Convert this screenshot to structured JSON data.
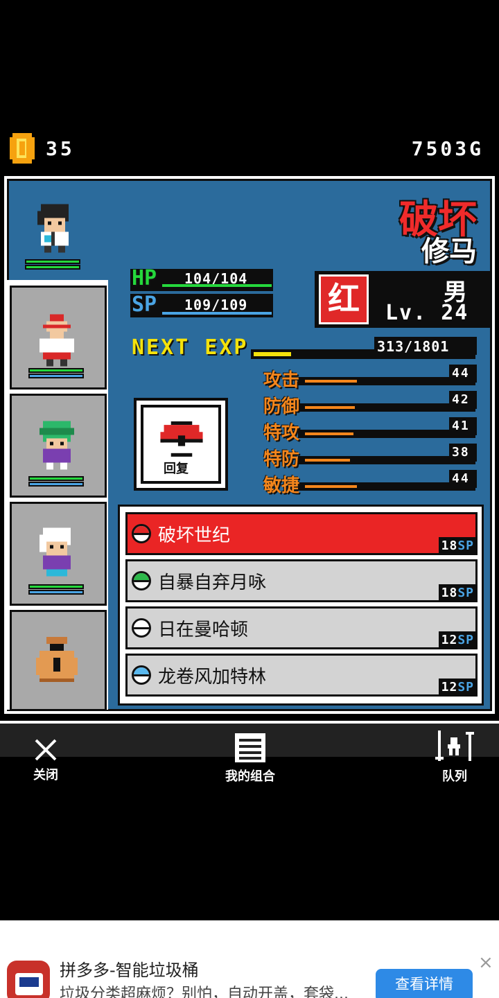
{
  "topbar": {
    "coins": "35",
    "gold": "7503G"
  },
  "character": {
    "title_red": "破坏",
    "name": "修马",
    "gender": "男",
    "type_badge": "红",
    "level": "Lv. 24"
  },
  "stats": {
    "hp": {
      "label": "HP",
      "value": "104/104",
      "fraction": 1.0
    },
    "sp": {
      "label": "SP",
      "value": "109/109",
      "fraction": 1.0
    },
    "exp": {
      "label": "NEXT EXP",
      "value": "313/1801",
      "fraction": 0.17
    }
  },
  "attributes": [
    {
      "name": "攻击",
      "value": "44"
    },
    {
      "name": "防御",
      "value": "42"
    },
    {
      "name": "特攻",
      "value": "41"
    },
    {
      "name": "特防",
      "value": "38"
    },
    {
      "name": "敏捷",
      "value": "44"
    }
  ],
  "item": {
    "label": "回复"
  },
  "skills": [
    {
      "name": "破坏世纪",
      "cost": "18",
      "unit": "SP",
      "ball_color": "#e02828",
      "active": true
    },
    {
      "name": "自暴自弃月咏",
      "cost": "18",
      "unit": "SP",
      "ball_color": "#2cb84a",
      "active": false
    },
    {
      "name": "日在曼哈顿",
      "cost": "12",
      "unit": "SP",
      "ball_color": "#ffffff",
      "active": false
    },
    {
      "name": "龙卷风加特林",
      "cost": "12",
      "unit": "SP",
      "ball_color": "#59b8ee",
      "active": false
    }
  ],
  "nav": {
    "close": "关闭",
    "combo": "我的组合",
    "queue": "队列"
  },
  "ad": {
    "title": "拼多多-智能垃圾桶",
    "desc": "垃圾分类超麻烦？别怕，自动开盖，套袋...",
    "button": "查看详情",
    "close": "×"
  },
  "colors": {
    "panel": "#2b6b9c",
    "hp": "#25d83c",
    "sp": "#4aa4e4",
    "exp": "#f5e20b",
    "attr": "#f4861c",
    "active_skill": "#ea2525"
  }
}
